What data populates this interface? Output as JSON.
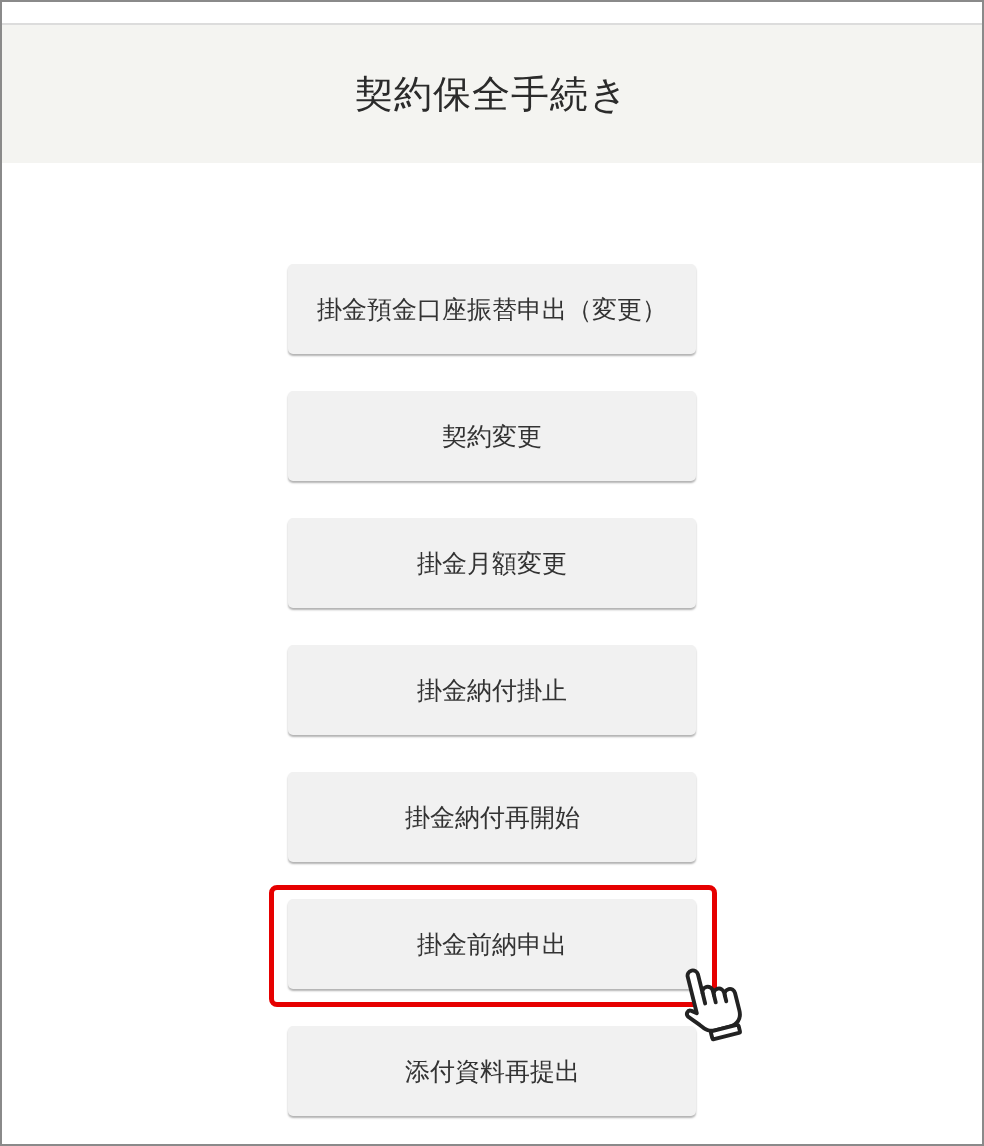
{
  "header": {
    "title": "契約保全手続き"
  },
  "buttons": [
    {
      "label": "掛金預金口座振替申出（変更）",
      "highlighted": false
    },
    {
      "label": "契約変更",
      "highlighted": false
    },
    {
      "label": "掛金月額変更",
      "highlighted": false
    },
    {
      "label": "掛金納付掛止",
      "highlighted": false
    },
    {
      "label": "掛金納付再開始",
      "highlighted": false
    },
    {
      "label": "掛金前納申出",
      "highlighted": true
    },
    {
      "label": "添付資料再提出",
      "highlighted": false
    }
  ]
}
